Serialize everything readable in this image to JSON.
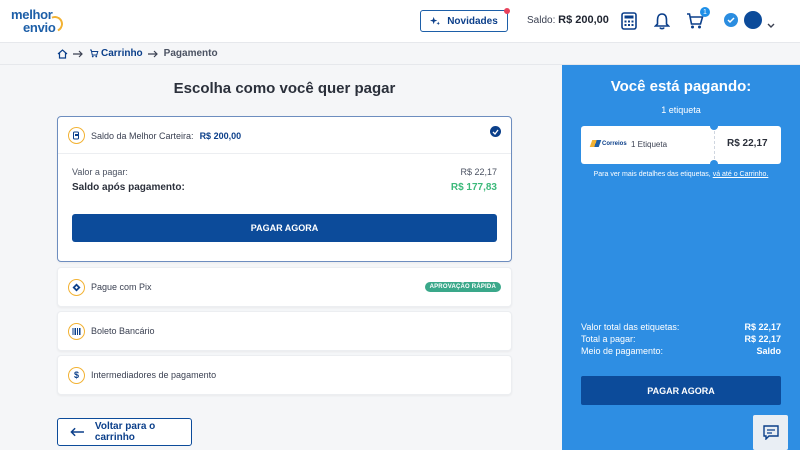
{
  "header": {
    "logo_line1": "melhor",
    "logo_line2": "envio",
    "news_label": "Novidades",
    "balance_label": "Saldo:",
    "balance_value": "R$ 200,00",
    "cart_count": "1",
    "icons": [
      "calculator-icon",
      "bell-icon",
      "cart-icon",
      "verified-icon",
      "chevron-down-icon"
    ]
  },
  "breadcrumb": {
    "items": [
      "Carrinho",
      "Pagamento"
    ]
  },
  "main": {
    "title": "Escolha como você quer pagar",
    "wallet": {
      "label": "Saldo da Melhor Carteira:",
      "amount": "R$ 200,00",
      "to_pay_label": "Valor a pagar:",
      "to_pay_value": "R$ 22,17",
      "after_label": "Saldo após pagamento:",
      "after_value": "R$ 177,83",
      "button": "PAGAR AGORA"
    },
    "options": [
      {
        "label": "Pague com Pix",
        "tag": "APROVAÇÃO RÁPIDA"
      },
      {
        "label": "Boleto Bancário"
      },
      {
        "label": "Intermediadores de pagamento"
      }
    ],
    "back_button": "Voltar para o carrinho"
  },
  "summary": {
    "title": "Você está pagando:",
    "count": "1 etiqueta",
    "carrier": "Correios",
    "ticket_label": "1 Etiqueta",
    "ticket_price": "R$ 22,17",
    "note_text": "Para ver mais detalhes das etiquetas,",
    "note_link": "vá até o Carrinho.",
    "rows": [
      {
        "label": "Valor total das etiquetas:",
        "value": "R$ 22,17"
      },
      {
        "label": "Total a pagar:",
        "value": "R$ 22,17"
      },
      {
        "label": "Meio de pagamento:",
        "value": "Saldo"
      }
    ],
    "button": "PAGAR AGORA"
  },
  "colors": {
    "primary": "#0c4b9a",
    "panel": "#2e8ee3",
    "accent": "#f2b233",
    "success": "#3cb97a"
  }
}
